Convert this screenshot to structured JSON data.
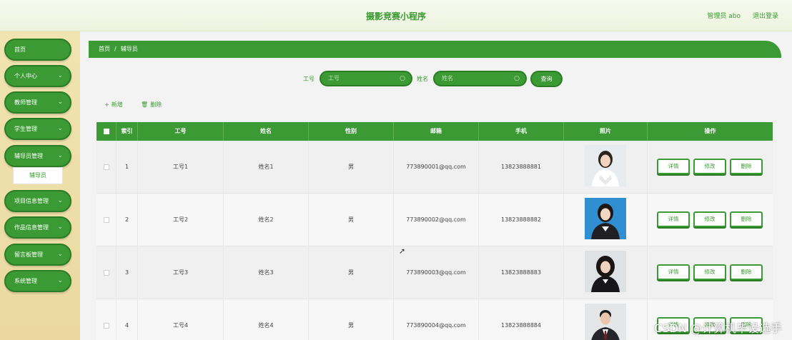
{
  "header": {
    "title": "摄影竞赛小程序",
    "user": "管理员 abo",
    "logout": "退出登录"
  },
  "sidebar": {
    "items": [
      {
        "label": "首页",
        "chevron": ""
      },
      {
        "label": "个人中心",
        "chevron": "⌄"
      },
      {
        "label": "教师管理",
        "chevron": "⌄"
      },
      {
        "label": "学生管理",
        "chevron": "⌄"
      },
      {
        "label": "辅导员管理",
        "chevron": "⌄"
      },
      {
        "label": "项目信息管理",
        "chevron": "⌄"
      },
      {
        "label": "作品信息管理",
        "chevron": "⌄"
      },
      {
        "label": "留言板管理",
        "chevron": "⌄"
      },
      {
        "label": "系统管理",
        "chevron": "⌄"
      }
    ],
    "sub_item": "辅导员"
  },
  "breadcrumb": {
    "home": "首页",
    "sep": "/",
    "current": "辅导员"
  },
  "search": {
    "id_label": "工号",
    "id_placeholder": "工号",
    "name_label": "姓名",
    "name_placeholder": "姓名",
    "button": "查询"
  },
  "actions": {
    "add": "新增",
    "delete": "删除"
  },
  "table": {
    "headers": [
      "索引",
      "工号",
      "姓名",
      "性别",
      "邮箱",
      "手机",
      "照片",
      "操作"
    ],
    "rows": [
      {
        "index": "1",
        "id": "工号1",
        "name": "姓名1",
        "gender": "男",
        "email": "773890001@qq.com",
        "phone": "13823888881",
        "photo": "female-portrait"
      },
      {
        "index": "2",
        "id": "工号2",
        "name": "姓名2",
        "gender": "男",
        "email": "773890002@qq.com",
        "phone": "13823888882",
        "photo": "female-portrait"
      },
      {
        "index": "3",
        "id": "工号3",
        "name": "姓名3",
        "gender": "男",
        "email": "773890003@qq.com",
        "phone": "13823888883",
        "photo": "female-portrait"
      },
      {
        "index": "4",
        "id": "工号4",
        "name": "姓名4",
        "gender": "男",
        "email": "773890004@qq.com",
        "phone": "13823888884",
        "photo": "male-portrait"
      }
    ],
    "row_buttons": {
      "detail": "详情",
      "edit": "修改",
      "delete": "删除"
    }
  },
  "watermark": "CSDN @计算机毕设选手",
  "colors": {
    "primary": "#3c9a35",
    "primary_dark": "#2a7d25",
    "sidebar_bg": "#f1e4b0",
    "header_bg": "#f6f9ee"
  }
}
